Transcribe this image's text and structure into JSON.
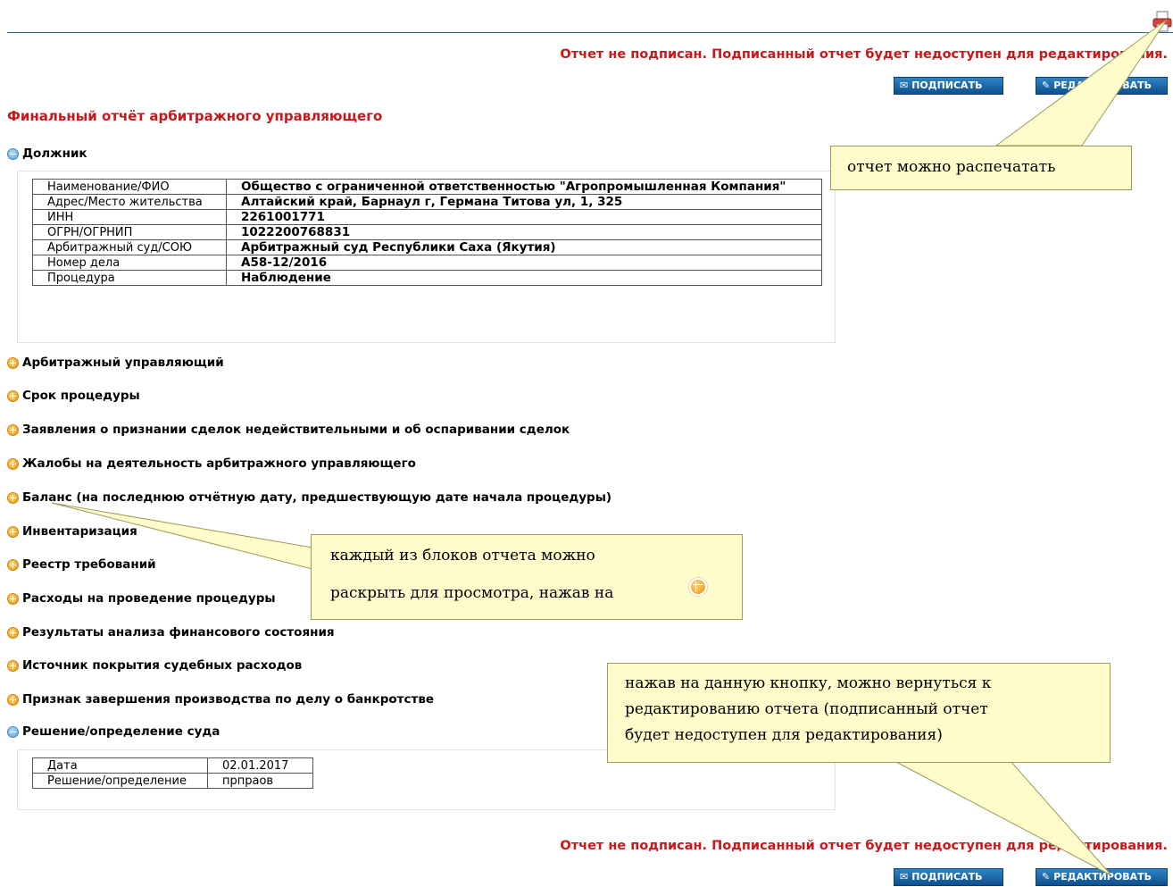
{
  "status_message": "Отчет не подписан. Подписанный отчет будет недоступен для редактирования.",
  "buttons": {
    "sign": "ПОДПИСАТЬ",
    "edit": "РЕДАКТИРОВАТЬ"
  },
  "title": "Финальный отчёт арбитражного управляющего",
  "debtor": {
    "header": "Должник",
    "rows": [
      {
        "label": "Наименование/ФИО",
        "value": "Общество с ограниченной ответственностью \"Агропромышленная Компания\""
      },
      {
        "label": "Адрес/Место жительства",
        "value": "Алтайский край, Барнаул г, Германа Титова ул, 1, 325"
      },
      {
        "label": "ИНН",
        "value": "2261001771"
      },
      {
        "label": "ОГРН/ОГРНИП",
        "value": "1022200768831"
      },
      {
        "label": "Арбитражный суд/СОЮ",
        "value": "Арбитражный суд Республики Саха (Якутия)"
      },
      {
        "label": "Номер дела",
        "value": "А58-12/2016"
      },
      {
        "label": "Процедура",
        "value": "Наблюдение"
      }
    ]
  },
  "sections": [
    "Арбитражный управляющий",
    "Срок процедуры",
    "Заявления о признании сделок недействительными и об оспаривании сделок",
    "Жалобы на деятельность арбитражного управляющего",
    "Баланс (на последнюю отчётную дату, предшествующую дате начала процедуры)",
    "Инвентаризация",
    "Реестр требований",
    "Расходы на проведение процедуры",
    "Результаты анализа финансового состояния",
    "Источник покрытия судебных расходов",
    "Признак завершения производства по делу о банкротстве"
  ],
  "decision": {
    "header": "Решение/определение суда",
    "rows": [
      {
        "label": "Дата",
        "value": "02.01.2017"
      },
      {
        "label": "Решение/определение",
        "value": "прпраов"
      }
    ]
  },
  "callouts": {
    "print": "отчет можно распечатать",
    "expand_line1": "каждый из блоков отчета можно",
    "expand_line2": "раскрыть для просмотра, нажав на",
    "edit_line1": "нажав на данную кнопку, можно вернуться к",
    "edit_line2": "редактированию отчета (подписанный отчет",
    "edit_line3": "будет недоступен для редактирования)"
  }
}
